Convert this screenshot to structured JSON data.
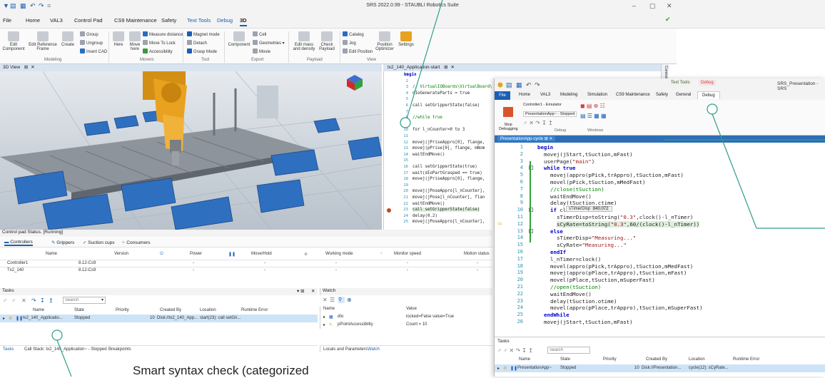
{
  "window": {
    "title": "SRS 2022.0.99 - STAUBLI Robotics Suite",
    "controls": [
      "–",
      "▢",
      "✕"
    ]
  },
  "menu": {
    "tabs": [
      "File",
      "Home",
      "VAL3",
      "Control Pad",
      "CS9 Maintenance",
      "Safety",
      "Text Tools",
      "Debug",
      "3D"
    ]
  },
  "ribbon": {
    "modeling": {
      "edit_component": "Edit\nComponent",
      "edit_reference_frame": "Edit Reference\nFrame",
      "create": "Create",
      "group": "Group",
      "ungroup": "Ungroup",
      "insert_cad": "Insert CAD",
      "label": "Modeling"
    },
    "movers": {
      "here": "Here",
      "move_here": "Move\nhere",
      "measure_distance": "Measure distance",
      "move_to_lock": "Move To Lock",
      "accessibility": "Accessibility",
      "label": "Movers"
    },
    "tool": {
      "magnet_mode": "Magnet mode",
      "detach": "Detach",
      "grasp_mode": "Grasp Mode",
      "label": "Tool"
    },
    "export": {
      "component": "Component",
      "cell": "Cell",
      "geometries": "Geometries",
      "movie": "Movie",
      "label": "Export"
    },
    "payload": {
      "edit_mass": "Edit mass\nand density",
      "check_payload": "Check\nPayload",
      "label": "Payload"
    },
    "view": {
      "catalog": "Catalog",
      "jog": "Jog",
      "edit_position": "Edit Position",
      "position_optimizer": "Position\nOptimizer",
      "settings": "Settings",
      "label": "View"
    }
  },
  "view3d": {
    "tab": "3D View",
    "side_tab": "Control"
  },
  "editor_top": {
    "tab": "tx2_140_Application-start",
    "lines": [
      {
        "n": "1",
        "t": "begin"
      },
      {
        "n": "2",
        "t": ""
      },
      {
        "n": "3",
        "t": "// VirtualIOBoards\\VirtualBoard\\"
      },
      {
        "n": "4",
        "t": "dIoGenerateParts = true"
      },
      {
        "n": "5",
        "t": ""
      },
      {
        "n": "6",
        "t": "call setGripperState(false)"
      },
      {
        "n": "7",
        "t": ""
      },
      {
        "n": "8",
        "t": "//while true"
      },
      {
        "n": "9",
        "t": ""
      },
      {
        "n": "10",
        "t": "for l_nCounter=0 to 3"
      },
      {
        "n": "11",
        "t": ""
      },
      {
        "n": "12",
        "t": "movej(jPriseAppro[0], flange,"
      },
      {
        "n": "13",
        "t": "movej(pPrise[0], flange, mNom"
      },
      {
        "n": "14",
        "t": "waitEndMove()"
      },
      {
        "n": "15",
        "t": ""
      },
      {
        "n": "16",
        "t": "call setGripperState(true)"
      },
      {
        "n": "17",
        "t": "wait(dIoPartGrasped == true)"
      },
      {
        "n": "18",
        "t": "movej(jPriseAppro[0], flange,"
      },
      {
        "n": "19",
        "t": ""
      },
      {
        "n": "20",
        "t": "movej(jPoseAppro[l_nCounter],"
      },
      {
        "n": "21",
        "t": "movej(jPose[l_nCounter], flan"
      },
      {
        "n": "22",
        "t": "waitEndMove()"
      },
      {
        "n": "23",
        "t": "call setGripperState(false)"
      },
      {
        "n": "24",
        "t": "delay(0.2)"
      },
      {
        "n": "25",
        "t": "movej(jPoseAppro[l_nCounter],"
      }
    ]
  },
  "control_pad": {
    "status": "Control pad Status. [Running]",
    "tabs": [
      "Controllers",
      "Grippers",
      "Suction cups",
      "Consumers"
    ],
    "columns": [
      "Name",
      "Version",
      "Power",
      "Move/Hold",
      "Working mode",
      "Monitor speed",
      "Motion status"
    ],
    "rows": [
      {
        "name": "Controller1",
        "version": "8.12-Cs9",
        "power": "-",
        "move": "-",
        "mode": "-",
        "speed": "-",
        "motion": "-"
      },
      {
        "name": "Tx2_140",
        "version": "8.12-Cs9",
        "power": "-",
        "move": "-",
        "mode": "-",
        "speed": "-",
        "motion": "-"
      }
    ]
  },
  "tasks": {
    "title": "Tasks",
    "search_placeholder": "Search",
    "columns": [
      "Name",
      "State",
      "Priority",
      "Created By",
      "Location",
      "Runtime Error"
    ],
    "row": {
      "name": "tx2_140_Applicatio...",
      "state": "Stopped",
      "priority": "10",
      "created_by": "Disk://tx2_140_App...",
      "location": "start(23): call setGri...",
      "error": ""
    },
    "bottom_tabs": [
      "Tasks",
      "Call Stack: tx2_140_Application~ - Stopped",
      "Breakpoints"
    ]
  },
  "watch": {
    "title": "Watch",
    "columns": [
      "Name",
      "Value"
    ],
    "rows": [
      {
        "name": "dIo",
        "value": "locked=False value=True"
      },
      {
        "name": "pPointAccessibility",
        "value": "Count = 10"
      }
    ],
    "bottom_tabs": [
      "Locals and Parameters",
      "Watch"
    ]
  },
  "overlay": {
    "title": "SRS_Presentation - SRS",
    "context_tabs": [
      "Text Tools",
      "Debug"
    ],
    "menus": [
      "File",
      "Home",
      "VAL3",
      "Modeling",
      "Simulation",
      "CS9 Maintenance",
      "Safety",
      "General",
      "Debug"
    ],
    "controller": "Controller1 - Emulator",
    "app_status": "PresentationApp~ - Stopped",
    "stop_label": "Stop\nDebugging",
    "group_debug": "Debug",
    "group_windows": "Windows",
    "doc_tab": "PresentationApp-cycle",
    "tooltip_name": "sTimerDisp",
    "tooltip_value": "840.072",
    "code": [
      {
        "n": "1",
        "ind": 0,
        "parts": [
          [
            "kw",
            "begin"
          ]
        ]
      },
      {
        "n": "2",
        "ind": 1,
        "parts": [
          [
            "",
            "movej(jStart,tSuction,mFast)"
          ]
        ]
      },
      {
        "n": "3",
        "ind": 1,
        "parts": [
          [
            "",
            "userPage("
          ],
          [
            "str",
            "\"main\""
          ],
          [
            "",
            ")"
          ]
        ]
      },
      {
        "n": "4",
        "ind": 1,
        "parts": [
          [
            "kw",
            "while true"
          ]
        ]
      },
      {
        "n": "5",
        "ind": 2,
        "parts": [
          [
            "",
            "movej(appro(pPick,trAppro),tSuction,mFast)"
          ]
        ]
      },
      {
        "n": "6",
        "ind": 2,
        "parts": [
          [
            "",
            "movel(pPick,tSuction,mMedFast)"
          ]
        ]
      },
      {
        "n": "7",
        "ind": 2,
        "parts": [
          [
            "cm",
            "//close(tSuction)"
          ]
        ]
      },
      {
        "n": "8",
        "ind": 2,
        "parts": [
          [
            "",
            "waitEndMove()"
          ]
        ]
      },
      {
        "n": "9",
        "ind": 2,
        "parts": [
          [
            "",
            "delay(tSuction.ctime)"
          ]
        ]
      },
      {
        "n": "10",
        "ind": 2,
        "parts": [
          [
            "kw",
            "if"
          ],
          [
            "",
            " cl"
          ]
        ]
      },
      {
        "n": "11",
        "ind": 3,
        "parts": [
          [
            "",
            "sTimerDisp=toString("
          ],
          [
            "str",
            "\"0.3\""
          ],
          [
            "",
            ",clock()-l_nTimer)"
          ]
        ]
      },
      {
        "n": "12",
        "ind": 3,
        "parts": [
          [
            "",
            "sCyRate=toString("
          ],
          [
            "str",
            "\"0.3\""
          ],
          [
            "",
            ",60/(clock()-l_nTimer))"
          ]
        ]
      },
      {
        "n": "13",
        "ind": 2,
        "parts": [
          [
            "kw",
            "else"
          ]
        ]
      },
      {
        "n": "14",
        "ind": 3,
        "parts": [
          [
            "",
            "sTimerDisp="
          ],
          [
            "str",
            "\"Measuring...\""
          ]
        ]
      },
      {
        "n": "15",
        "ind": 3,
        "parts": [
          [
            "",
            "sCyRate="
          ],
          [
            "str",
            "\"Measuring...\""
          ]
        ]
      },
      {
        "n": "16",
        "ind": 2,
        "parts": [
          [
            "kw",
            "endIf"
          ]
        ]
      },
      {
        "n": "17",
        "ind": 2,
        "parts": [
          [
            "",
            "l_nTimer=clock()"
          ]
        ]
      },
      {
        "n": "18",
        "ind": 2,
        "parts": [
          [
            "",
            "movel(appro(pPick,trAppro),tSuction,mMedFast)"
          ]
        ]
      },
      {
        "n": "19",
        "ind": 2,
        "parts": [
          [
            "",
            "movej(appro(pPlace,trAppro),tSuction,mFast)"
          ]
        ]
      },
      {
        "n": "20",
        "ind": 2,
        "parts": [
          [
            "",
            "movel(pPlace,tSuction,mSuperFast)"
          ]
        ]
      },
      {
        "n": "21",
        "ind": 2,
        "parts": [
          [
            "cm",
            "//open(tSuction)"
          ]
        ]
      },
      {
        "n": "22",
        "ind": 2,
        "parts": [
          [
            "",
            "waitEndMove()"
          ]
        ]
      },
      {
        "n": "23",
        "ind": 2,
        "parts": [
          [
            "",
            "delay(tSuction.otime)"
          ]
        ]
      },
      {
        "n": "24",
        "ind": 2,
        "parts": [
          [
            "",
            "movel(appro(pPlace,trAppro),tSuction,mSuperFast)"
          ]
        ]
      },
      {
        "n": "25",
        "ind": 1,
        "parts": [
          [
            "kw",
            "endWhile"
          ]
        ]
      },
      {
        "n": "26",
        "ind": 1,
        "parts": [
          [
            "",
            "movej(jStart,tSuction,mFast)"
          ]
        ]
      }
    ],
    "tasks": {
      "title": "Tasks",
      "search_placeholder": "Search",
      "columns": [
        "Name",
        "State",
        "Priority",
        "Created By",
        "Location",
        "Runtime Error"
      ],
      "row": {
        "name": "PresentationApp~",
        "state": "Stopped",
        "priority": "10",
        "created_by": "Disk://Presentation...",
        "location": "cycle(12): sCyRate...",
        "error": ""
      }
    }
  },
  "annotation": "Smart syntax check (categorized",
  "colors": {
    "accent": "#1a5fb4",
    "robot": "#e8a21f",
    "bin": "#2f6fc0",
    "annotation_line": "#2e9e8a"
  }
}
